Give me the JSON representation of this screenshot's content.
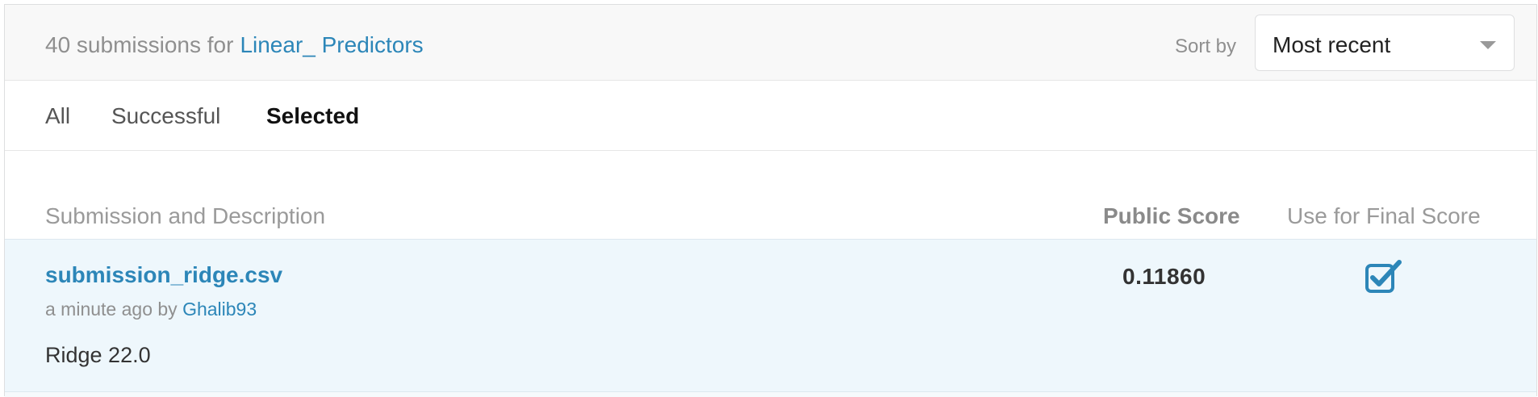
{
  "header": {
    "count_text": "40 submissions for",
    "competition_link": "Linear_ Predictors",
    "sort_label": "Sort by",
    "sort_value": "Most recent"
  },
  "tabs": [
    {
      "label": "All",
      "active": false
    },
    {
      "label": "Successful",
      "active": false
    },
    {
      "label": "Selected",
      "active": true
    }
  ],
  "table": {
    "columns": [
      "Submission and Description",
      "Public Score",
      "Use for Final Score"
    ],
    "rows": [
      {
        "filename": "submission_ridge.csv",
        "time": "a minute ago by",
        "user": "Ghalib93",
        "description": "Ridge 22.0",
        "public_score": "0.11860",
        "use_for_final": true
      }
    ]
  },
  "icons": {
    "sort_chevron": "chevron-down-icon",
    "final_checkbox": "checkbox-checked-icon"
  },
  "colors": {
    "link": "#2c86b8",
    "row_highlight": "#eef7fc",
    "header_bg": "#f8f8f8"
  }
}
